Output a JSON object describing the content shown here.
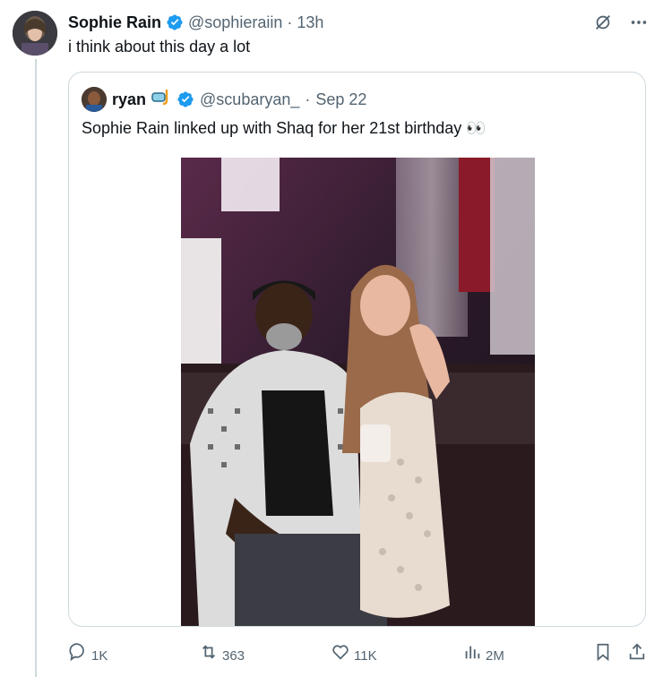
{
  "tweet": {
    "author_name": "Sophie Rain",
    "author_handle": "@sophieraiin",
    "separator": "·",
    "time": "13h",
    "text": "i think about this day a lot"
  },
  "quote": {
    "author_name": "ryan",
    "author_handle": "@scubaryan_",
    "separator": "·",
    "time": "Sep 22",
    "text": "Sophie Rain linked up with Shaq for her 21st birthday 👀"
  },
  "actions": {
    "replies": "1K",
    "reposts": "363",
    "likes": "11K",
    "views": "2M"
  },
  "icons": {
    "grok": "grok-icon",
    "more": "more-icon",
    "verified": "verified-badge-icon",
    "reply": "reply-icon",
    "repost": "repost-icon",
    "like": "like-icon",
    "views": "views-icon",
    "bookmark": "bookmark-icon",
    "share": "share-icon",
    "diving_mask": "diving-mask-icon"
  },
  "colors": {
    "verified": "#1d9bf0",
    "text_primary": "#0f1419",
    "text_secondary": "#536471",
    "border": "#cfd9de"
  }
}
